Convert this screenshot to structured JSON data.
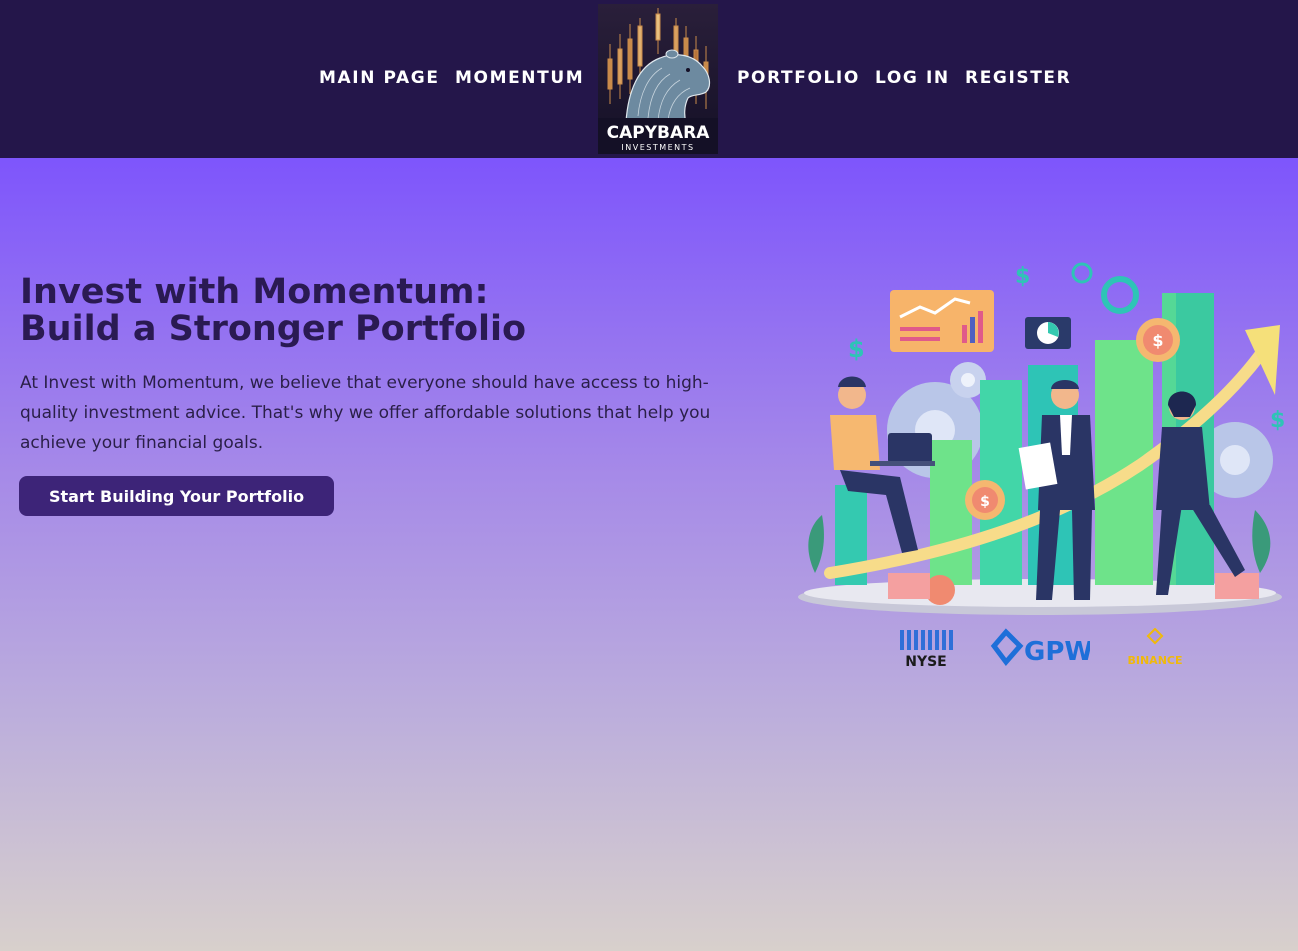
{
  "nav": {
    "items": [
      {
        "label": "MAIN PAGE"
      },
      {
        "label": "MOMENTUM"
      },
      {
        "label": "PORTFOLIO"
      },
      {
        "label": "LOG IN"
      },
      {
        "label": "REGISTER"
      }
    ]
  },
  "logo": {
    "wordmark": "CAPYBARA",
    "tagline": "INVESTMENTS"
  },
  "hero": {
    "headline_line1": "Invest with Momentum:",
    "headline_line2": "Build a Stronger Portfolio",
    "body": "At Invest with Momentum, we believe that everyone should have access to high-quality investment advice. That's why we offer affordable solutions that help you achieve your financial goals.",
    "cta_label": "Start Building Your Portfolio"
  },
  "exchanges": [
    {
      "name": "NYSE"
    },
    {
      "name": "GPW"
    },
    {
      "name": "BINANCE"
    }
  ],
  "colors": {
    "navbar_bg": "#24164a",
    "hero_gradient_top": "#7e55fc",
    "hero_gradient_bottom": "#d8d0cc",
    "headline_text": "#2a1a52",
    "cta_bg": "#3d2478",
    "binance_gold": "#f0b90b",
    "gpw_blue": "#1e6fd9"
  }
}
